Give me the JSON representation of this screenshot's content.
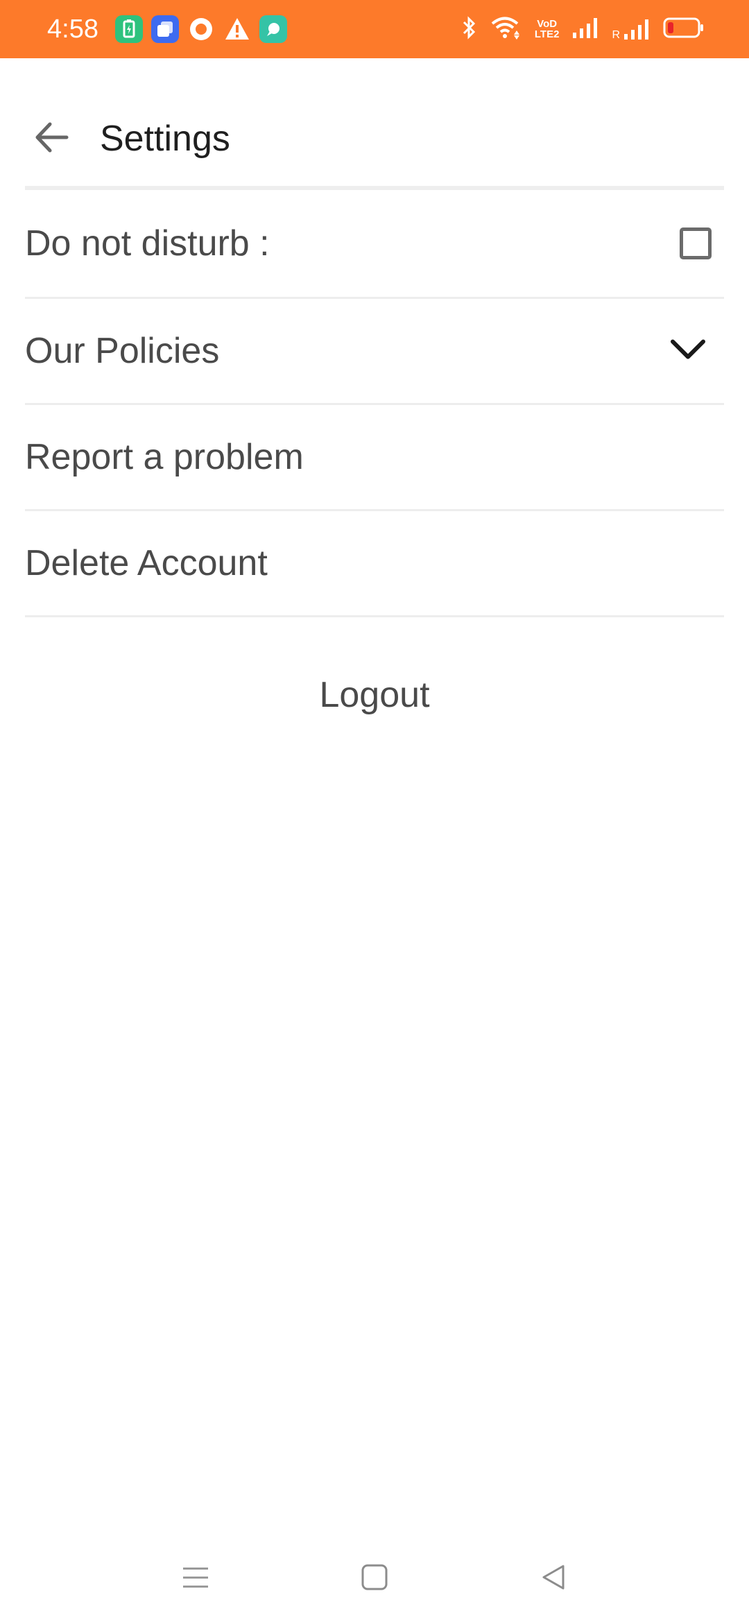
{
  "status_bar": {
    "time": "4:58",
    "volte_top": "VoD",
    "volte_bottom": "LTE2",
    "roaming": "R",
    "color": "#FD7A2A"
  },
  "header": {
    "title": "Settings"
  },
  "settings": {
    "dnd_label": "Do not disturb :",
    "dnd_checked": false,
    "policies_label": "Our Policies",
    "report_label": "Report a problem",
    "delete_label": "Delete Account"
  },
  "logout_label": "Logout",
  "nav": {
    "menu_icon": "menu-icon",
    "home_icon": "home-icon",
    "back_icon": "back-triangle-icon"
  }
}
